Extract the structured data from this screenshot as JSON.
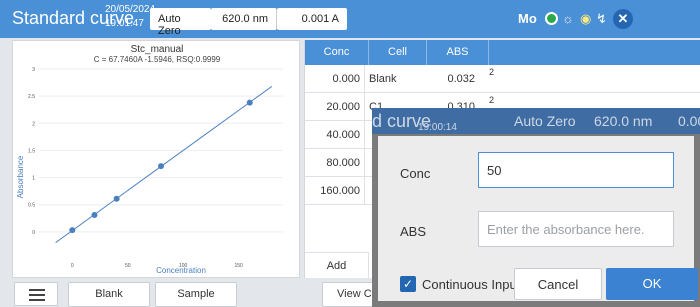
{
  "header": {
    "title": "Standard curve",
    "date": "20/05/2024",
    "time": "19:01:47",
    "auto_zero": "Auto Zero",
    "wavelength": "620.0 nm",
    "current": "0.001 A",
    "icons": [
      "mo-icon",
      "status-green-icon",
      "bulb-icon",
      "lamp-icon",
      "usb-icon",
      "close-icon"
    ],
    "mo_label": "Mo"
  },
  "chart_data": {
    "type": "scatter",
    "title": "Stc_manual",
    "subtitle": "C = 67.7460A -1.5946, RSQ:0.9999",
    "xlabel": "Concentration",
    "ylabel": "Absorbance",
    "xlim": [
      -30,
      190
    ],
    "ylim": [
      -0.5,
      3.0
    ],
    "xticks": [
      0,
      50,
      100,
      150
    ],
    "yticks": [
      0,
      0.5,
      1,
      1.5,
      2,
      2.5,
      3
    ],
    "xtick_labels": [
      "0",
      "50",
      "100",
      "150"
    ],
    "ytick_labels": [
      "0",
      "0.5",
      "1",
      "1.5",
      "2",
      "2.5",
      "3"
    ],
    "points": [
      {
        "x": 0,
        "y": 0.032
      },
      {
        "x": 20,
        "y": 0.31
      },
      {
        "x": 40,
        "y": 0.61
      },
      {
        "x": 80,
        "y": 1.21
      },
      {
        "x": 160,
        "y": 2.38
      }
    ],
    "fit": {
      "slope_conc_per_abs": 67.746,
      "intercept": -1.5946
    },
    "grid": true,
    "color": "#4a7fc0"
  },
  "table": {
    "headers": [
      "Conc",
      "Cell",
      "ABS"
    ],
    "rows": [
      {
        "conc": "0.000",
        "cell": "Blank",
        "abs": "0.032",
        "extra": "2"
      },
      {
        "conc": "20.000",
        "cell": "C1",
        "abs": "0.310",
        "extra": "2"
      },
      {
        "conc": "40.000",
        "cell": "",
        "abs": "",
        "extra": ""
      },
      {
        "conc": "80.000",
        "cell": "",
        "abs": "",
        "extra": ""
      },
      {
        "conc": "160.000",
        "cell": "",
        "abs": "",
        "extra": ""
      }
    ],
    "add_label": "Add"
  },
  "toolbar": {
    "blank": "Blank",
    "sample": "Sample",
    "view_chart": "View Ch"
  },
  "ghost": {
    "title_fragment": "d curve",
    "time": "19:00:14",
    "auto_zero": "Auto Zero",
    "wavelength": "620.0 nm",
    "current": "0.00"
  },
  "dialog": {
    "conc_label": "Conc",
    "conc_value": "50",
    "abs_label": "ABS",
    "abs_placeholder": "Enter the absorbance here.",
    "continuous_input": "Continuous Input",
    "continuous_checked": true,
    "cancel": "Cancel",
    "ok": "OK"
  }
}
